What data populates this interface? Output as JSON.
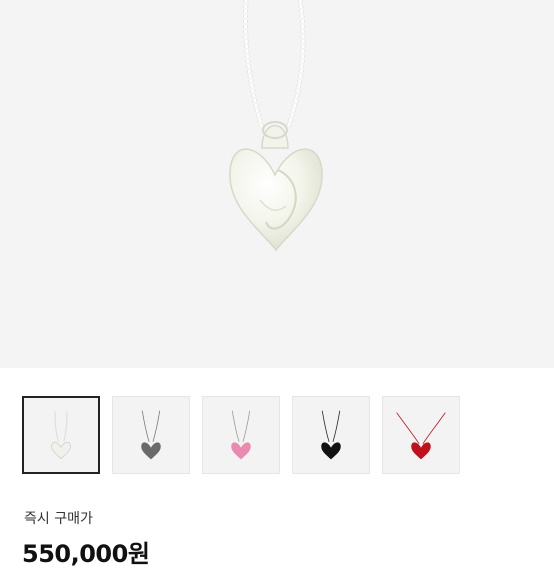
{
  "product": {
    "main_image_icon": "heart-pendant-necklace-white",
    "thumbnails": [
      {
        "icon": "heart-pendant-white",
        "color": "#f1f1ec",
        "selected": true
      },
      {
        "icon": "heart-pendant-gray",
        "color": "#6a6a6a",
        "selected": false
      },
      {
        "icon": "heart-pendant-pink",
        "color": "#e98ab0",
        "selected": false
      },
      {
        "icon": "heart-pendant-black",
        "color": "#111111",
        "selected": false
      },
      {
        "icon": "heart-pendant-red",
        "color": "#c0101c",
        "selected": false
      }
    ]
  },
  "purchase": {
    "label": "즉시 구매가",
    "price": "550,000원"
  }
}
